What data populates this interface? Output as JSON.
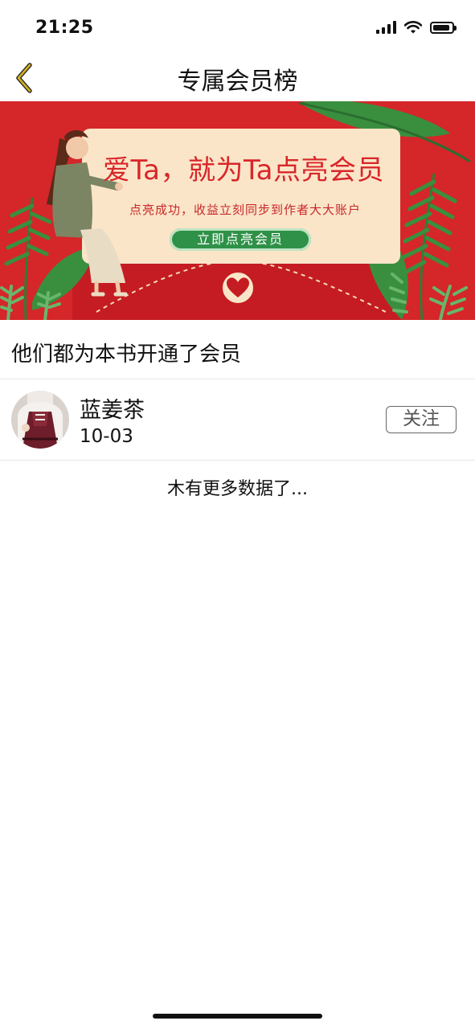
{
  "status_bar": {
    "time": "21:25",
    "icons": [
      "cellular-signal-icon",
      "wifi-icon",
      "battery-icon"
    ],
    "battery_level": 0.9
  },
  "nav": {
    "back_icon": "chevron-left-icon",
    "title": "专属会员榜"
  },
  "banner": {
    "headline": "爱Ta，就为Ta点亮会员",
    "subtext": "点亮成功，收益立刻同步到作者大大账户",
    "cta_label": "立即点亮会员",
    "colors": {
      "background": "#d5262a",
      "card": "#fbe5c8",
      "cta": "#2e9147",
      "leaf": "#3a8f3f"
    }
  },
  "section": {
    "title": "他们都为本书开通了会员"
  },
  "members": [
    {
      "name": "蓝姜茶",
      "date": "10-03",
      "follow_label": "关注"
    }
  ],
  "footer": {
    "end_text": "木有更多数据了..."
  },
  "colors": {
    "accent": "#c9a21a",
    "text": "#111111",
    "divider": "#e8e8e8"
  }
}
